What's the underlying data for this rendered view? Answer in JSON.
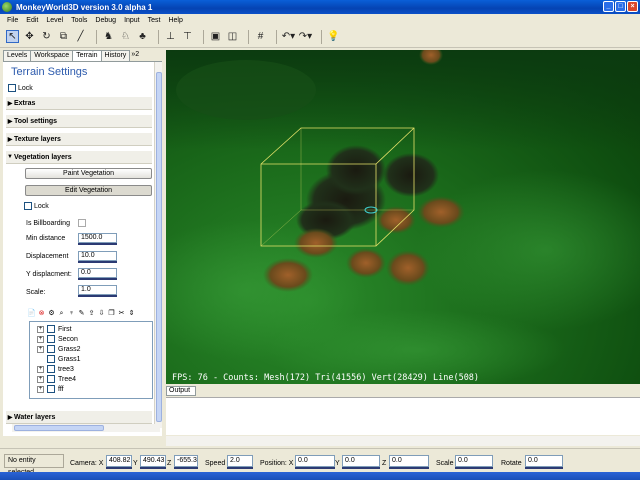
{
  "window": {
    "title": "MonkeyWorld3D version 3.0 alpha 1"
  },
  "menu": [
    "File",
    "Edit",
    "Level",
    "Tools",
    "Debug",
    "Input",
    "Test",
    "Help"
  ],
  "tabs": {
    "items": [
      "Levels",
      "Workspace",
      "Terrain",
      "History"
    ],
    "active": "Terrain",
    "more": "»2"
  },
  "terrain": {
    "title": "Terrain Settings",
    "lock_label": "Lock",
    "sections": {
      "extras": "Extras",
      "tool_settings": "Tool settings",
      "texture_layers": "Texture layers",
      "vegetation_layers": "Vegetation layers",
      "water_layers": "Water layers"
    },
    "vegetation": {
      "paint_label": "Paint Vegetation",
      "edit_label": "Edit Vegetation",
      "lock_label": "Lock",
      "billboarding_label": "Is Billboarding",
      "min_distance_label": "Min distance",
      "min_distance_value": "1500.0",
      "displacement_label": "Displacement",
      "displacement_value": "10.0",
      "y_displacement_label": "Y displacment:",
      "y_displacement_value": "0.0",
      "scale_label": "Scale:",
      "scale_value": "1.0"
    },
    "tree_items": [
      {
        "label": "First",
        "expandable": true
      },
      {
        "label": "Secon",
        "expandable": true
      },
      {
        "label": "Grass2",
        "expandable": true
      },
      {
        "label": "Grass1",
        "expandable": false
      },
      {
        "label": "tree3",
        "expandable": true
      },
      {
        "label": "Tree4",
        "expandable": true
      },
      {
        "label": "fff",
        "expandable": true
      }
    ]
  },
  "viewport": {
    "stats": "FPS: 76 - Counts: Mesh(172) Tri(41556) Vert(28429) Line(508)"
  },
  "output": {
    "tab_label": "Output"
  },
  "status": {
    "entity": "No entity selected.",
    "camera_label": "Camera: X",
    "camera_x": "408.82",
    "y_label": "Y",
    "camera_y": "490.43",
    "z_label": "Z",
    "camera_z": "-655.3",
    "speed_label": "Speed",
    "speed_value": "2.0",
    "position_label": "Position: X",
    "position_x": "0.0",
    "position_y": "0.0",
    "position_z": "0.0",
    "scale_label": "Scale",
    "scale_value": "0.0",
    "rotate_label": "Rotate",
    "rotate_value": "0.0"
  },
  "colors": {
    "title_bar": "#0a5fd8",
    "accent_text": "#2d5bad",
    "selection_box": "#e6e36a",
    "terrain_green": "#1b6b1b"
  }
}
